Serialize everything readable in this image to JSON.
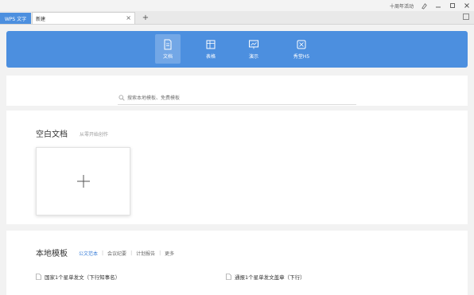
{
  "titlebar": {
    "right_text": "十周年活动",
    "icons": [
      "skin-icon",
      "minimize-icon",
      "maximize-icon",
      "close-icon"
    ]
  },
  "tabs": {
    "app_label": "WPS 文字",
    "doc_label": "新建",
    "close_glyph": "×",
    "add_glyph": "+"
  },
  "nav": {
    "items": [
      {
        "label": "文档",
        "icon": "document-icon",
        "active": true
      },
      {
        "label": "表格",
        "icon": "spreadsheet-icon",
        "active": false
      },
      {
        "label": "演示",
        "icon": "presentation-icon",
        "active": false
      },
      {
        "label": "秀堂H5",
        "icon": "h5-icon",
        "active": false
      }
    ]
  },
  "search": {
    "placeholder": "搜索本地模板、免费模板"
  },
  "blank": {
    "title": "空白文档",
    "subtitle": "从零开始创作",
    "plus_glyph": "+"
  },
  "local": {
    "title": "本地模板",
    "tabs": [
      "公文范本",
      "会议纪要",
      "计划报告",
      "更多"
    ],
    "files": [
      "国家1个星单发文（下行知事名）",
      "通报1个星单发文盖章（下行）"
    ]
  },
  "colors": {
    "accent": "#4c8fdf",
    "link": "#3a7ed8"
  }
}
